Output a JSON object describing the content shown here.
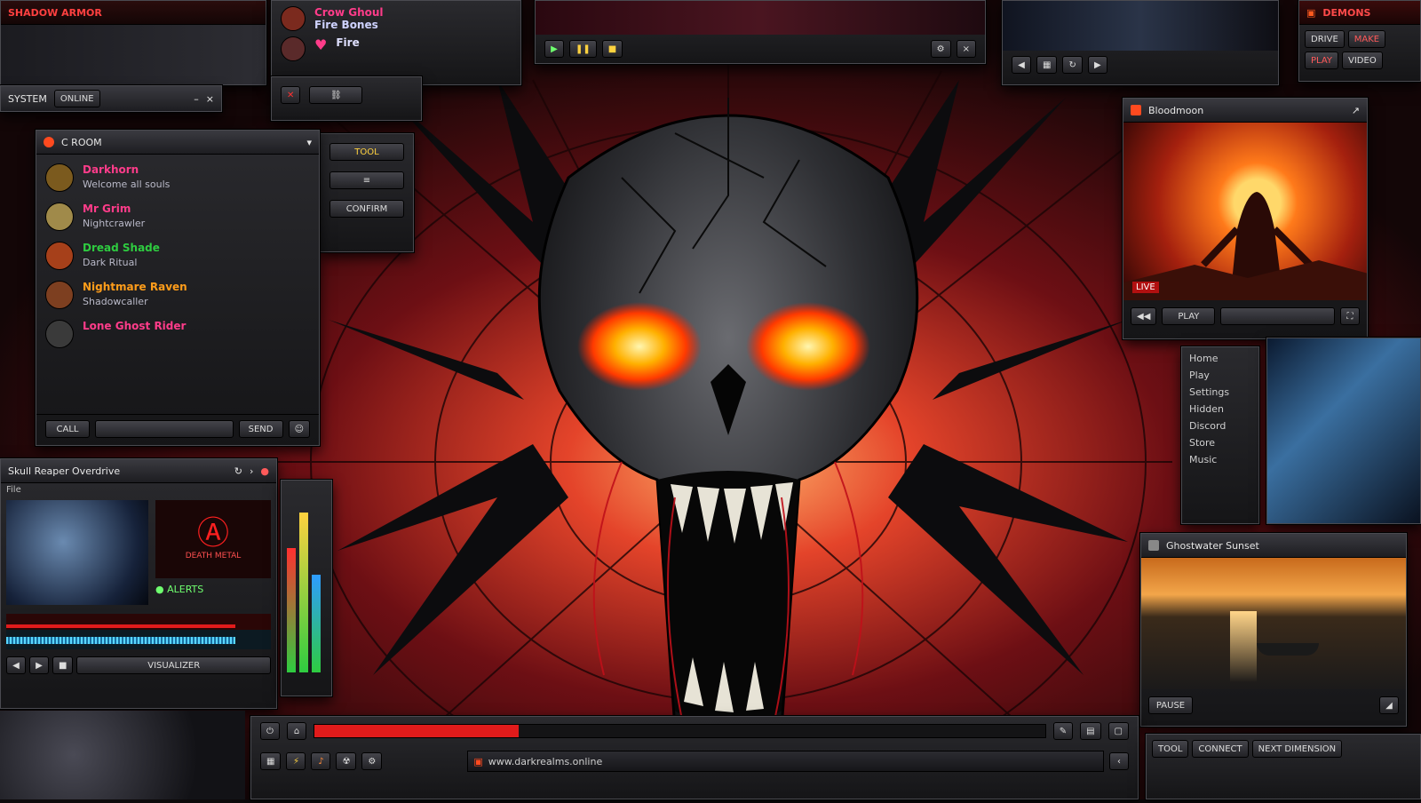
{
  "chat_window": {
    "title": "C ROOM",
    "messages": [
      {
        "name": "Darkhorn",
        "color": "#ff3c8a",
        "text": "Welcome all souls",
        "avatar_color": "#7b5a1e"
      },
      {
        "name": "Mr Grim",
        "color": "#ff3c8a",
        "text": "Nightcrawler",
        "avatar_color": "#a08a4a"
      },
      {
        "name": "Dread Shade",
        "color": "#2ecc40",
        "text": "Dark Ritual",
        "avatar_color": "#a6401a"
      },
      {
        "name": "Nightmare Raven",
        "color": "#ff9d1a",
        "text": "Shadowcaller",
        "avatar_color": "#7d3f20"
      },
      {
        "name": "Lone Ghost Rider",
        "color": "#ff3c8a",
        "text": "",
        "avatar_color": "#3a3a3a"
      }
    ],
    "footer_buttons": [
      "CALL",
      "",
      "SEND",
      ""
    ]
  },
  "video_window": {
    "title": "Bloodmoon",
    "status": "LIVE",
    "control": "PLAY"
  },
  "lake_window": {
    "title": "Ghostwater Sunset",
    "control": "PAUSE"
  },
  "media_player": {
    "title": "Skull Reaper Overdrive",
    "tab": "File",
    "logo_caption": "DEATH METAL",
    "status_text": "● ALERTS",
    "footer_buttons": [
      "",
      "",
      "",
      "",
      "VISUALIZER"
    ]
  },
  "side_menu": {
    "items": [
      "Home",
      "Play",
      "Settings",
      "Hidden",
      "Discord",
      "Store",
      "Music"
    ]
  },
  "top_left_panel": {
    "title": "SHADOW ARMOR"
  },
  "top_friends": {
    "items": [
      {
        "name": "Crow Ghoul"
      },
      {
        "name": "Fire Bones"
      },
      {
        "name": "Fire"
      }
    ]
  },
  "mid_tool": {
    "buttons": [
      "TOOL",
      "CONFIRM"
    ]
  },
  "left_strip": {
    "title": "SYSTEM",
    "btn": "ONLINE"
  },
  "top_right": {
    "title": "DEMONS",
    "items": [
      "DRIVE",
      "MAKE",
      "PLAY",
      "VIDEO"
    ]
  },
  "bottom_right": {
    "tabs": [
      "TOOL",
      "CONNECT",
      "NEXT DIMENSION"
    ]
  },
  "taskbar": {
    "url": "www.darkrealms.online",
    "progress_pct": 28
  },
  "colors": {
    "accent": "#e11b1b",
    "panel": "#1d1d21",
    "glow": "#ffb347"
  }
}
